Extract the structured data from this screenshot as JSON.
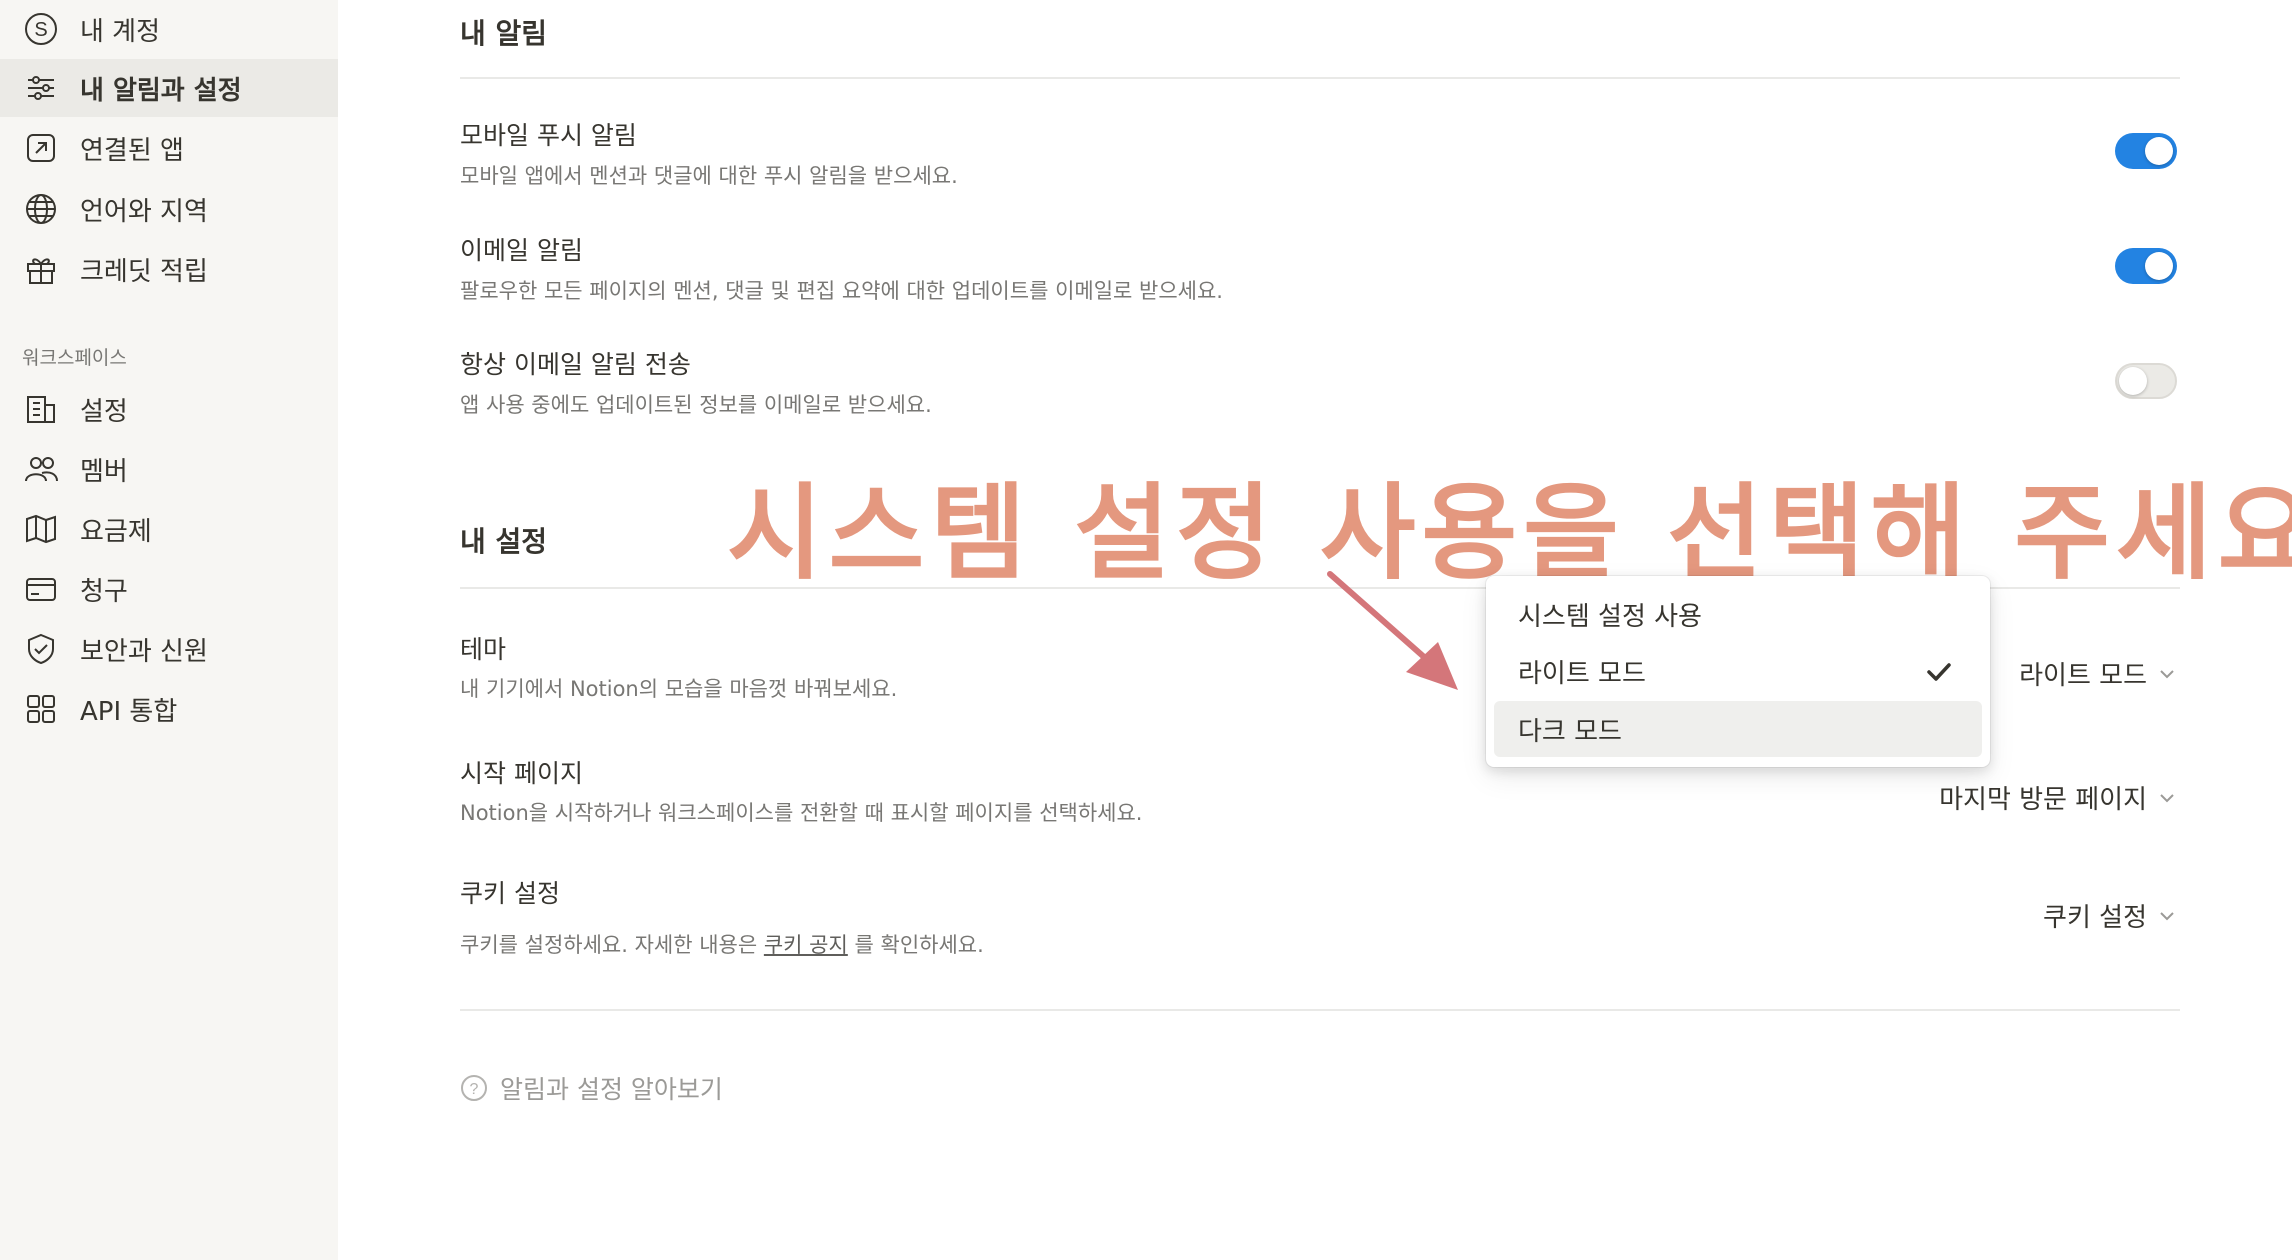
{
  "sidebar": {
    "items": [
      {
        "label": "내 계정",
        "icon": "account-s-icon"
      },
      {
        "label": "내 알림과 설정",
        "icon": "sliders-icon",
        "active": true
      },
      {
        "label": "연결된 앱",
        "icon": "external-link-icon"
      },
      {
        "label": "언어와 지역",
        "icon": "globe-icon"
      },
      {
        "label": "크레딧 적립",
        "icon": "gift-icon"
      }
    ],
    "workspace_label": "워크스페이스",
    "workspace_items": [
      {
        "label": "설정",
        "icon": "building-icon"
      },
      {
        "label": "멤버",
        "icon": "people-icon"
      },
      {
        "label": "요금제",
        "icon": "map-icon"
      },
      {
        "label": "청구",
        "icon": "credit-card-icon"
      },
      {
        "label": "보안과 신원",
        "icon": "shield-check-icon"
      },
      {
        "label": "API 통합",
        "icon": "grid-icon"
      }
    ]
  },
  "notifications": {
    "title": "내 알림",
    "mobile_push": {
      "title": "모바일 푸시 알림",
      "desc": "모바일 앱에서 멘션과 댓글에 대한 푸시 알림을 받으세요.",
      "enabled": true
    },
    "email": {
      "title": "이메일 알림",
      "desc": "팔로우한 모든 페이지의 멘션, 댓글 및 편집 요약에 대한 업데이트를 이메일로 받으세요.",
      "enabled": true
    },
    "always_email": {
      "title": "항상 이메일 알림 전송",
      "desc": "앱 사용 중에도 업데이트된 정보를 이메일로 받으세요.",
      "enabled": false
    }
  },
  "settings": {
    "title": "내 설정",
    "theme": {
      "title": "테마",
      "desc": "내 기기에서 Notion의 모습을 마음껏 바꿔보세요.",
      "value": "라이트 모드"
    },
    "start_page": {
      "title": "시작 페이지",
      "desc": "Notion을 시작하거나 워크스페이스를 전환할 때 표시할 페이지를 선택하세요.",
      "value": "마지막 방문 페이지"
    },
    "cookie": {
      "title": "쿠키 설정",
      "desc_before": "쿠키를 설정하세요. 자세한 내용은 ",
      "desc_link": "쿠키 공지",
      "desc_after": " 를 확인하세요.",
      "value": "쿠키 설정"
    }
  },
  "theme_dropdown": {
    "options": [
      {
        "label": "시스템 설정 사용",
        "selected": false,
        "hover": false
      },
      {
        "label": "라이트 모드",
        "selected": true,
        "hover": false
      },
      {
        "label": "다크 모드",
        "selected": false,
        "hover": true
      }
    ]
  },
  "help_link": "알림과 설정 알아보기",
  "annotation": {
    "text": "시스템 설정 사용을 선택해 주세요!",
    "color": "#e4987f"
  },
  "colors": {
    "toggle_on": "#2383e2",
    "sidebar_bg": "#f7f6f3",
    "active_bg": "#ebeae6"
  }
}
